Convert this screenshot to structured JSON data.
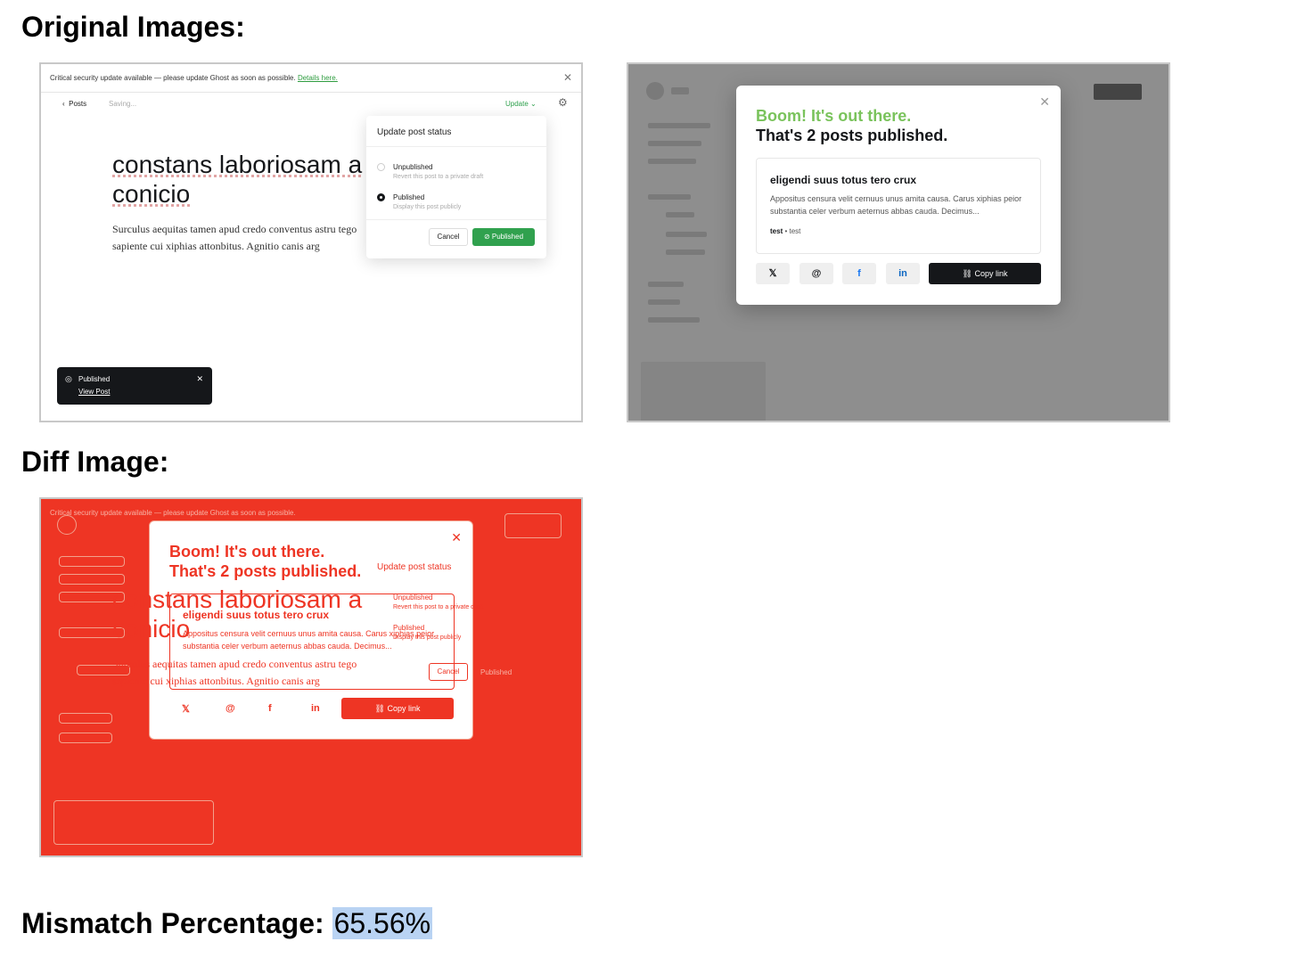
{
  "headings": {
    "original": "Original Images:",
    "diff": "Diff Image:",
    "mismatch_label": "Mismatch Percentage:",
    "mismatch_value": "65.56%"
  },
  "editor": {
    "banner_text": "Critical security update available — please update Ghost as soon as possible.",
    "banner_link": "Details here.",
    "back_label": "Posts",
    "saving_label": "Saving...",
    "update_label": "Update",
    "post_title": "constans laboriosam a conicio",
    "post_body": "Surculus aequitas tamen apud credo conventus astru tego sapiente cui xiphias attonbitus. Agnitio canis arg",
    "popover": {
      "title": "Update post status",
      "options": [
        {
          "label": "Unpublished",
          "desc": "Revert this post to a private draft",
          "selected": false
        },
        {
          "label": "Published",
          "desc": "Display this post publicly",
          "selected": true
        }
      ],
      "cancel_label": "Cancel",
      "publish_label": "Published"
    },
    "toast": {
      "title": "Published",
      "link": "View Post"
    }
  },
  "modal": {
    "boom": "Boom! It's out there.",
    "count": "That's 2 posts published.",
    "card_title": "eligendi suus totus tero crux",
    "card_excerpt": "Appositus censura velit cernuus unus amita causa. Carus xiphias peior substantia celer verbum aeternus abbas cauda. Decimus...",
    "card_author": "test",
    "card_tag": "test",
    "share_icons": [
      "x-icon",
      "threads-icon",
      "facebook-icon",
      "linkedin-icon"
    ],
    "copy_label": "Copy link"
  },
  "colors": {
    "accent_green": "#30a14e",
    "boom_green": "#7ac35c",
    "diff_red": "#ee3524",
    "dark": "#15171a"
  }
}
